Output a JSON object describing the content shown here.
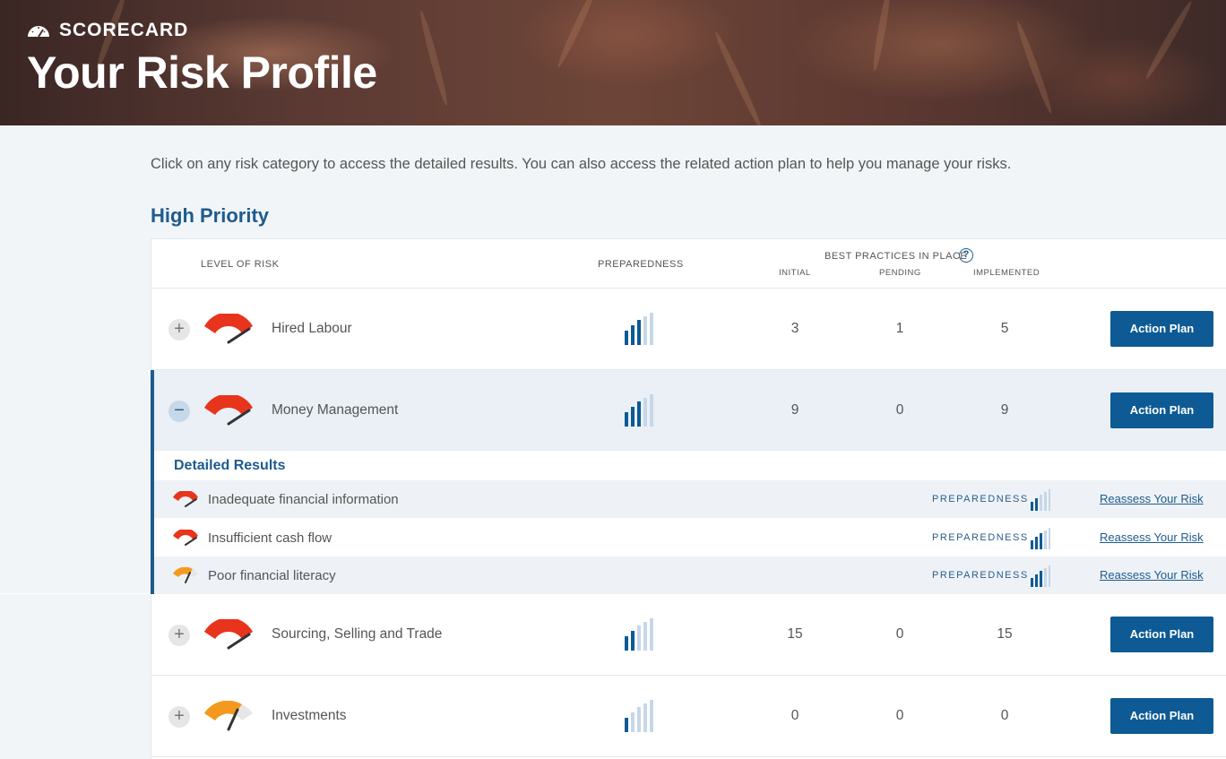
{
  "header": {
    "label": "SCORECARD",
    "title": "Your Risk Profile"
  },
  "intro": "Click on any risk category to access the detailed results. You can also access the related action plan to help you manage your risks.",
  "section_title": "High Priority",
  "table": {
    "col_level": "LEVEL OF RISK",
    "col_preparedness": "PREPAREDNESS",
    "col_best_practices": "BEST PRACTICES IN PLACE",
    "col_initial": "INITIAL",
    "col_pending": "PENDING",
    "col_implemented": "IMPLEMENTED",
    "help_icon": "?"
  },
  "rows": [
    {
      "name": "Hired Labour",
      "toggle": "+",
      "risk_level": "high",
      "preparedness_bars": 3,
      "initial": "3",
      "pending": "1",
      "implemented": "5",
      "action": "Action Plan"
    },
    {
      "name": "Money Management",
      "toggle": "−",
      "risk_level": "high",
      "preparedness_bars": 3,
      "initial": "9",
      "pending": "0",
      "implemented": "9",
      "action": "Action Plan"
    },
    {
      "name": "Sourcing, Selling and Trade",
      "toggle": "+",
      "risk_level": "high",
      "preparedness_bars": 2,
      "initial": "15",
      "pending": "0",
      "implemented": "15",
      "action": "Action Plan"
    },
    {
      "name": "Investments",
      "toggle": "+",
      "risk_level": "medium",
      "preparedness_bars": 1,
      "initial": "0",
      "pending": "0",
      "implemented": "0",
      "action": "Action Plan"
    }
  ],
  "details": {
    "title": "Detailed Results",
    "items": [
      {
        "name": "Inadequate financial information",
        "risk_level": "high",
        "preparedness_label": "PREPAREDNESS",
        "preparedness_bars": 2,
        "link": "Reassess Your Risk"
      },
      {
        "name": "Insufficient cash flow",
        "risk_level": "high",
        "preparedness_label": "PREPAREDNESS",
        "preparedness_bars": 3,
        "link": "Reassess Your Risk"
      },
      {
        "name": "Poor financial literacy",
        "risk_level": "medium",
        "preparedness_label": "PREPAREDNESS",
        "preparedness_bars": 3,
        "link": "Reassess Your Risk"
      }
    ]
  },
  "colors": {
    "high_risk": "#e8341c",
    "medium_risk": "#f39a1e",
    "primary": "#0d5a94",
    "heading": "#1d5b8f"
  },
  "icons": {
    "header": "speedometer-icon",
    "gauge": "risk-gauge-icon",
    "preparedness": "signal-bars-icon"
  }
}
